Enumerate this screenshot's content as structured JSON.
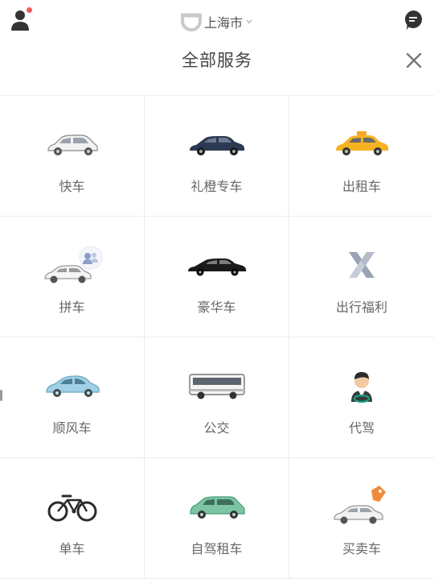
{
  "header": {
    "city": "上海市",
    "title": "全部服务",
    "icons": {
      "profile": "person-icon",
      "message": "message-icon",
      "close": "close-icon",
      "brand": "didi-logo-icon",
      "dropdown": "chevron-down-icon"
    },
    "badge_color": "#f25b5b"
  },
  "services": [
    {
      "label": "快车",
      "icon": "car-icon"
    },
    {
      "label": "礼橙专车",
      "icon": "premier-car-icon"
    },
    {
      "label": "出租车",
      "icon": "taxi-icon"
    },
    {
      "label": "拼车",
      "icon": "carpool-icon"
    },
    {
      "label": "豪华车",
      "icon": "luxury-car-icon"
    },
    {
      "label": "出行福利",
      "icon": "benefits-icon"
    },
    {
      "label": "顺风车",
      "icon": "hitch-car-icon"
    },
    {
      "label": "公交",
      "icon": "bus-icon"
    },
    {
      "label": "代驾",
      "icon": "designated-driver-icon"
    },
    {
      "label": "单车",
      "icon": "bicycle-icon"
    },
    {
      "label": "自驾租车",
      "icon": "car-rental-icon"
    },
    {
      "label": "买卖车",
      "icon": "car-trade-icon"
    }
  ]
}
